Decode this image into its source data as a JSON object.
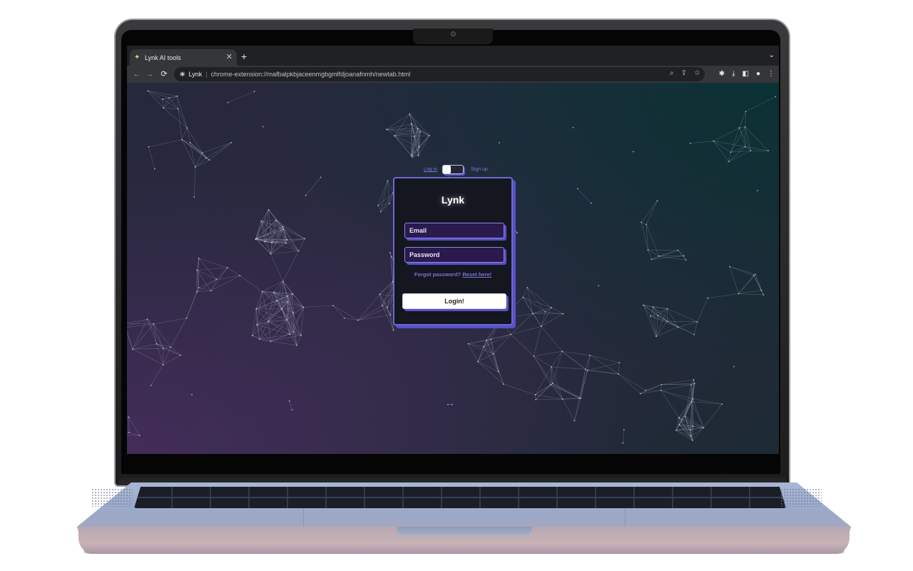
{
  "browser": {
    "tab": {
      "title": "Lynk AI tools",
      "favicon": "lynk-favicon-icon",
      "close_icon": "✕"
    },
    "new_tab_icon": "+",
    "tab_search_icon": "⌄",
    "nav": {
      "back": "←",
      "forward": "→",
      "reload": "⟳"
    },
    "omnibox": {
      "extension_icon": "puzzle-icon",
      "extension_name": "Lynk",
      "separator": "|",
      "url": "chrome-extension://mafbalpkbjaceenmgbgmlfdjoanafnmh/newtab.html",
      "actions": [
        "zoom-icon",
        "share-icon",
        "bookmark-star-icon"
      ]
    },
    "toolbar_icons": [
      "extensions-icon",
      "downloads-icon",
      "side-panel-icon",
      "profile-icon",
      "menu-icon"
    ]
  },
  "auth": {
    "toggle": {
      "login_label": "Log in",
      "signup_label": "Sign up",
      "state": "login"
    },
    "card": {
      "title": "Lynk",
      "email_placeholder": "Email",
      "password_placeholder": "Password",
      "forgot_text": "Forgot password?",
      "reset_link": "Reset here!",
      "login_button": "Login!"
    }
  },
  "colors": {
    "accent": "#5851c7",
    "link": "#7b74d8",
    "card_bg": "#141620",
    "field_bg": "#2a1a4e"
  }
}
